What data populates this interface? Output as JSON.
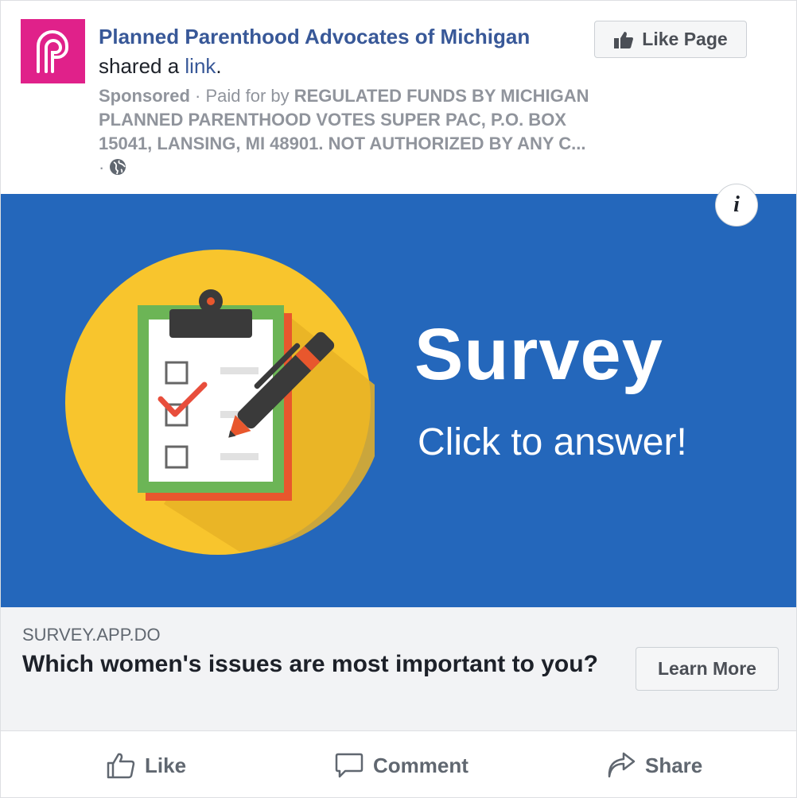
{
  "post": {
    "page_name": "Planned Parenthood Advocates of Michigan",
    "shared_text": " shared a ",
    "link_word": "link",
    "period": ".",
    "sponsored": "Sponsored",
    "separator": " · ",
    "paid_for_by": "Paid for by ",
    "funder": "REGULATED FUNDS BY MICHIGAN PLANNED PARENTHOOD VOTES SUPER PAC, P.O. BOX 15041, LANSING, MI 48901. NOT AUTHORIZED BY ANY C...",
    "globe_separator": " · ",
    "like_page_label": "Like Page"
  },
  "creative": {
    "info_label": "i",
    "title": "Survey",
    "subtitle": "Click to answer!"
  },
  "link_preview": {
    "domain": "SURVEY.APP.DO",
    "headline": "Which women's issues are most important to you?",
    "cta_label": "Learn More"
  },
  "actions": {
    "like": "Like",
    "comment": "Comment",
    "share": "Share"
  },
  "colors": {
    "brand_pink": "#e0218a",
    "link_blue": "#385898",
    "hero_blue": "#2467bb",
    "circle_yellow": "#f8c52d"
  }
}
